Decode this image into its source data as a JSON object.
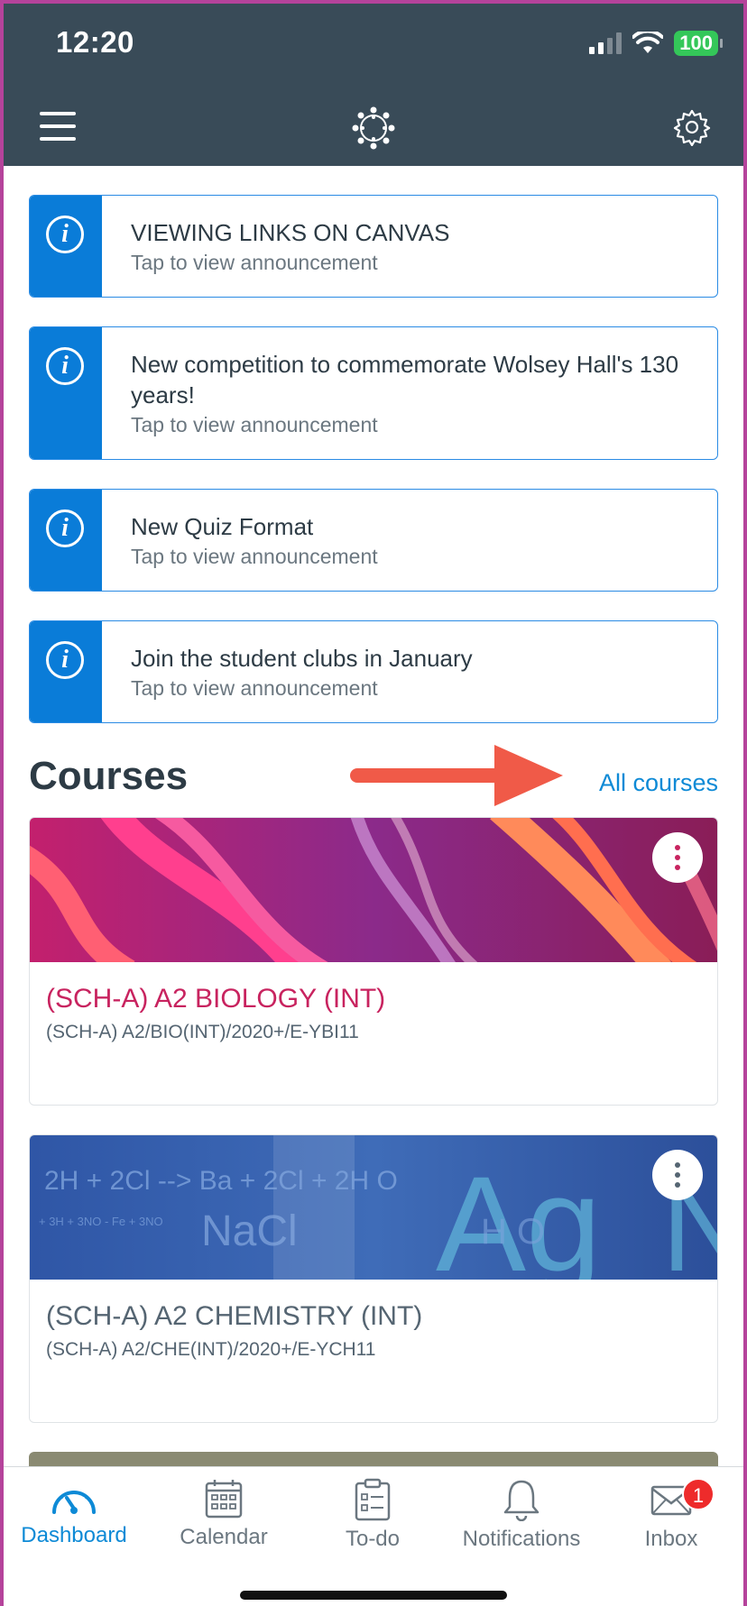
{
  "status_bar": {
    "time": "12:20",
    "battery": "100"
  },
  "announcements": [
    {
      "title": "VIEWING LINKS ON CANVAS",
      "subtitle": "Tap to view announcement"
    },
    {
      "title": "New competition to commemorate Wolsey Hall's 130 years!",
      "subtitle": "Tap to view announcement"
    },
    {
      "title": "New Quiz Format",
      "subtitle": "Tap to view announcement"
    },
    {
      "title": "Join the student clubs in January",
      "subtitle": "Tap to view announcement"
    }
  ],
  "courses": {
    "heading": "Courses",
    "all_link": "All courses",
    "items": [
      {
        "name": "(SCH-A) A2 BIOLOGY (INT)",
        "code": "(SCH-A) A2/BIO(INT)/2020+/E-YBI11",
        "color": "#c8235f"
      },
      {
        "name": "(SCH-A) A2 CHEMISTRY (INT)",
        "code": "(SCH-A) A2/CHE(INT)/2020+/E-YCH11",
        "color": "#556572"
      }
    ]
  },
  "tabbar": {
    "tabs": [
      {
        "label": "Dashboard",
        "icon": "dashboard-icon",
        "active": true
      },
      {
        "label": "Calendar",
        "icon": "calendar-icon"
      },
      {
        "label": "To-do",
        "icon": "todo-icon"
      },
      {
        "label": "Notifications",
        "icon": "bell-icon"
      },
      {
        "label": "Inbox",
        "icon": "mail-icon",
        "badge": "1"
      }
    ]
  },
  "colors": {
    "header": "#394b58",
    "accent": "#0e8ad6",
    "announcement": "#0a7cd8",
    "annotation_arrow": "#f05a48"
  }
}
